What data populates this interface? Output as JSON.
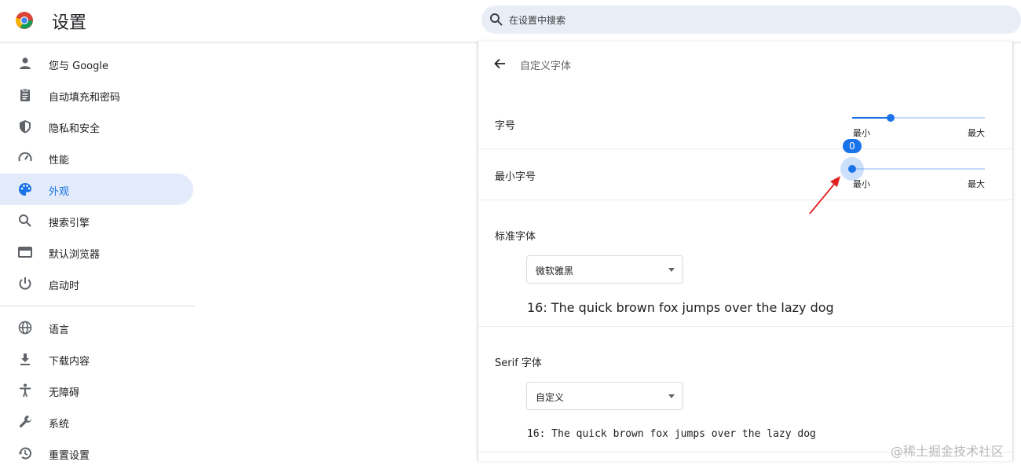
{
  "app": {
    "title": "设置"
  },
  "search": {
    "placeholder": "在设置中搜索"
  },
  "sidebar": {
    "items": [
      {
        "label": "您与 Google",
        "icon": "person-icon"
      },
      {
        "label": "自动填充和密码",
        "icon": "clipboard-icon"
      },
      {
        "label": "隐私和安全",
        "icon": "shield-icon"
      },
      {
        "label": "性能",
        "icon": "speedometer-icon"
      },
      {
        "label": "外观",
        "icon": "palette-icon",
        "active": true
      },
      {
        "label": "搜索引擎",
        "icon": "search-icon"
      },
      {
        "label": "默认浏览器",
        "icon": "browser-icon"
      },
      {
        "label": "启动时",
        "icon": "power-icon"
      },
      {
        "label": "语言",
        "icon": "globe-icon"
      },
      {
        "label": "下载内容",
        "icon": "download-icon"
      },
      {
        "label": "无障碍",
        "icon": "accessibility-icon"
      },
      {
        "label": "系统",
        "icon": "wrench-icon"
      },
      {
        "label": "重置设置",
        "icon": "history-icon"
      }
    ]
  },
  "panel": {
    "title": "自定义字体",
    "font_size": {
      "label": "字号",
      "min_label": "最小",
      "max_label": "最大",
      "level": 0.29
    },
    "min_font_size": {
      "label": "最小字号",
      "min_label": "最小",
      "max_label": "最大",
      "value": "0",
      "level": 0
    },
    "standard_font": {
      "label": "标准字体",
      "selected": "微软雅黑",
      "sample": "16: The quick brown fox jumps over the lazy dog"
    },
    "serif_font": {
      "label": "Serif 字体",
      "selected": "自定义",
      "sample": "16: The quick brown fox jumps over the lazy dog"
    }
  },
  "colors": {
    "accent": "#1a73e8",
    "annotation": "#e02020"
  },
  "watermark": "@稀土掘金技术社区"
}
